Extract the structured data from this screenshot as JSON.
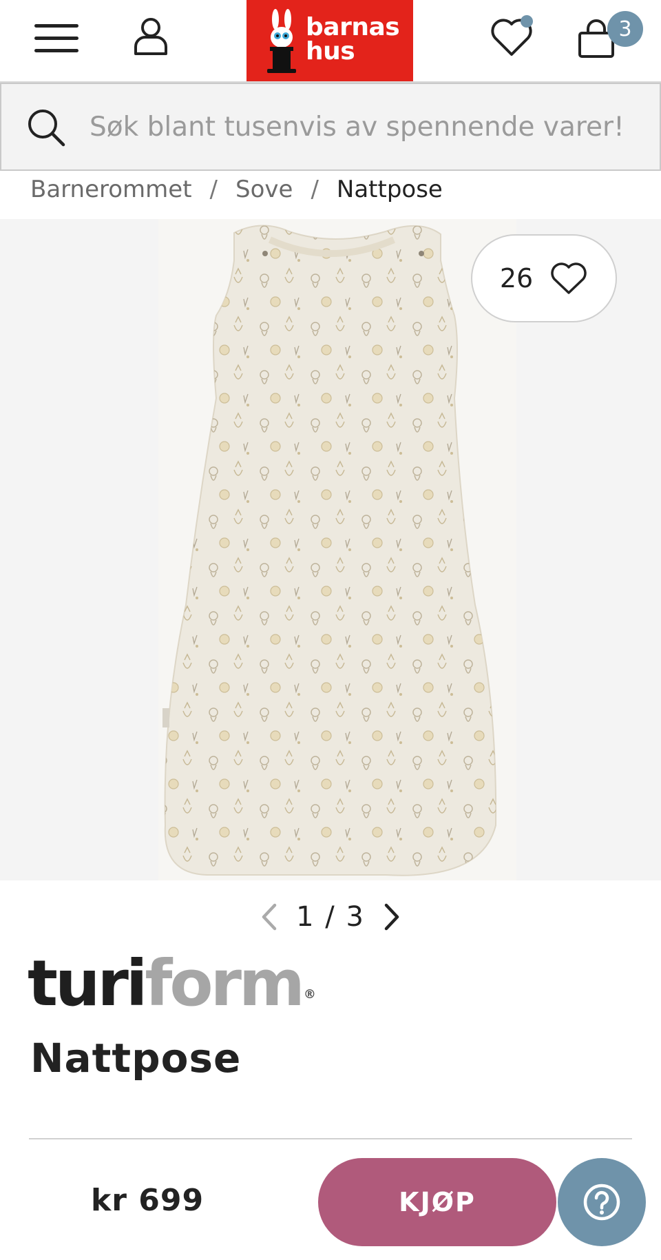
{
  "header": {
    "menu_icon": "hamburger-icon",
    "user_icon": "user-icon",
    "logo_line1": "barnas",
    "logo_line2": "hus",
    "wishlist_icon": "heart-icon",
    "cart_icon": "bag-icon",
    "cart_count": "3",
    "brand_red": "#e3231b",
    "badge_color": "#6f93aa"
  },
  "search": {
    "placeholder": "Søk blant tusenvis av spennende varer!",
    "icon": "search-icon"
  },
  "breadcrumb": {
    "items": [
      "Barnerommet",
      "Sove",
      "Nattpose"
    ],
    "separator": "/"
  },
  "gallery": {
    "favorite_count": "26",
    "page_indicator": "1 / 3",
    "current_page": 1,
    "total_pages": 3
  },
  "product": {
    "brand_part1": "turi",
    "brand_part2": "form",
    "brand_mark": "®",
    "title": "Nattpose",
    "price": "kr 699"
  },
  "actions": {
    "buy_label": "KJØP",
    "buy_color": "#b05a7b",
    "help_icon": "question-icon"
  }
}
